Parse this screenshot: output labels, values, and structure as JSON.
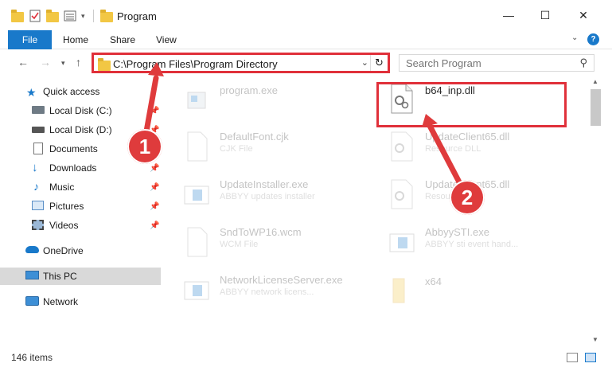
{
  "window": {
    "title": "Program",
    "minimize": "—",
    "maximize": "☐",
    "close": "✕"
  },
  "ribbon": {
    "tabs": [
      "File",
      "Home",
      "Share",
      "View"
    ]
  },
  "address": {
    "path": "C:\\Program Files\\Program Directory"
  },
  "search": {
    "placeholder": "Search Program"
  },
  "sidebar": {
    "items": [
      {
        "label": "Quick access",
        "icon": "star-icon"
      },
      {
        "label": "Local Disk (C:)",
        "icon": "drive-icon"
      },
      {
        "label": "Local Disk (D:)",
        "icon": "drive-icon"
      },
      {
        "label": "Documents",
        "icon": "documents-icon"
      },
      {
        "label": "Downloads",
        "icon": "download-icon"
      },
      {
        "label": "Music",
        "icon": "music-icon"
      },
      {
        "label": "Pictures",
        "icon": "pictures-icon"
      },
      {
        "label": "Videos",
        "icon": "videos-icon"
      },
      {
        "label": "OneDrive",
        "icon": "cloud-icon"
      },
      {
        "label": "This PC",
        "icon": "computer-icon"
      },
      {
        "label": "Network",
        "icon": "network-icon"
      }
    ]
  },
  "files": [
    {
      "name": "program.exe",
      "desc": ""
    },
    {
      "name": "b64_inp.dll",
      "desc": ""
    },
    {
      "name": "DefaultFont.cjk",
      "desc": "CJK File"
    },
    {
      "name": "UpdateClient65.dll",
      "desc": "Resource DLL"
    },
    {
      "name": "UpdateInstaller.exe",
      "desc": "ABBYY updates installer"
    },
    {
      "name": "UpdateClient65.dll",
      "desc": "Resource DLL"
    },
    {
      "name": "SndToWP16.wcm",
      "desc": "WCM File"
    },
    {
      "name": "AbbyySTI.exe",
      "desc": "ABBYY sti event hand..."
    },
    {
      "name": "NetworkLicenseServer.exe",
      "desc": "ABBYY network licens..."
    },
    {
      "name": "x64",
      "desc": ""
    }
  ],
  "status": {
    "count": "146 items"
  },
  "annotations": [
    "1",
    "2"
  ],
  "colors": {
    "accent": "#1979ca",
    "highlight": "#e0303a"
  }
}
